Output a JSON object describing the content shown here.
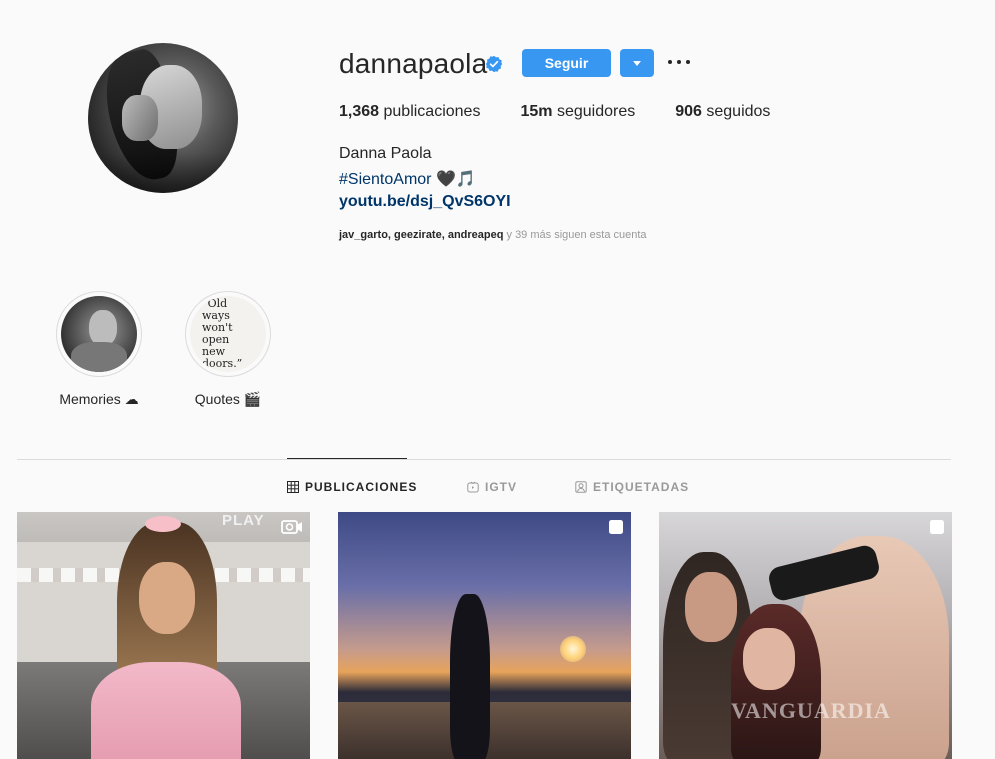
{
  "profile": {
    "username": "dannapaola",
    "follow_label": "Seguir",
    "stats": {
      "posts_count": "1,368",
      "posts_label": "publicaciones",
      "followers_count": "15m",
      "followers_label": "seguidores",
      "following_count": "906",
      "following_label": "seguidos"
    },
    "full_name": "Danna Paola",
    "bio_hashtag": "#SientoAmor",
    "bio_emoji": "🖤🎵",
    "bio_link": "youtu.be/dsj_QvS6OYI",
    "followed_by": {
      "users": "jav_garto, geezirate, andreapeq",
      "suffix": " y 39 más siguen esta cuenta"
    }
  },
  "highlights": [
    {
      "label": "Memories ☁"
    },
    {
      "label": "Quotes 🎬",
      "cover_text": "“Old ways won't open new doors.”"
    }
  ],
  "tabs": [
    {
      "label": "PUBLICACIONES",
      "icon": "grid-icon",
      "active": true
    },
    {
      "label": "IGTV",
      "icon": "igtv-icon",
      "active": false
    },
    {
      "label": "ETIQUETADAS",
      "icon": "tagged-icon",
      "active": false
    }
  ],
  "posts": [
    {
      "type": "video",
      "overlay_text": "PLAY"
    },
    {
      "type": "carousel"
    },
    {
      "type": "carousel",
      "watermark": "VANGUARDIA"
    }
  ],
  "colors": {
    "accent": "#3897f0",
    "link": "#003569",
    "background": "#fafafa"
  }
}
